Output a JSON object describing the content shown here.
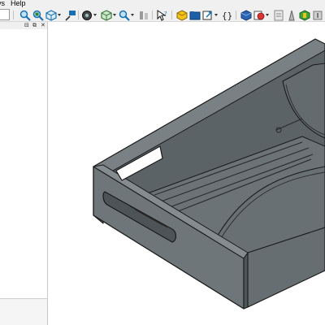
{
  "menubar": {
    "items": [
      {
        "label": "vs"
      },
      {
        "label": "Help"
      }
    ]
  },
  "toolbar": {
    "buttons": [
      {
        "icon": "zoom-fit-all-icon"
      },
      {
        "icon": "zoom-fit-selection-icon"
      },
      {
        "icon": "standard-views-cube-icon"
      },
      {
        "icon": "measure-tool-icon"
      },
      {
        "icon": "view-isometric-box-icon"
      },
      {
        "icon": "draw-style-icon"
      },
      {
        "icon": "view-box-icon"
      },
      {
        "icon": "zoom-icon"
      },
      {
        "icon": "clipping-tool-icon"
      },
      {
        "icon": "whats-this-help-icon"
      },
      {
        "icon": "create-part-icon"
      },
      {
        "icon": "create-group-folder-icon"
      },
      {
        "icon": "link-make-icon"
      },
      {
        "icon": "macro-braces-icon"
      },
      {
        "icon": "sketcher-workbench-icon"
      },
      {
        "icon": "part-boolean-icon"
      },
      {
        "icon": "text-document-icon"
      },
      {
        "icon": "part-feature-icon"
      },
      {
        "icon": "workbench-switch-icon"
      },
      {
        "icon": "addon-icon"
      }
    ]
  },
  "leftpanel": {
    "controls": [
      "⊟",
      "⧉",
      "✕"
    ]
  },
  "colors": {
    "model_face": "#6f767a",
    "model_top": "#676e72",
    "model_edge": "#1a1a1a",
    "background": "#ffffff"
  }
}
